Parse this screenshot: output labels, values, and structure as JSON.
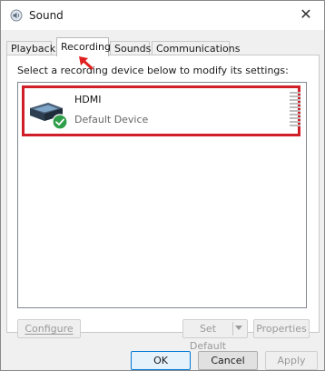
{
  "window": {
    "title": "Sound",
    "close_glyph": "✕"
  },
  "tabs": [
    {
      "label": "Playback",
      "active": false
    },
    {
      "label": "Recording",
      "active": true
    },
    {
      "label": "Sounds",
      "active": false
    },
    {
      "label": "Communications",
      "active": false
    }
  ],
  "recording": {
    "instruction": "Select a recording device below to modify its settings:",
    "devices": [
      {
        "name": "HDMI",
        "status": "Default Device",
        "icon": "hdmi-device-icon",
        "default_badge": "check-icon"
      }
    ]
  },
  "buttons": {
    "configure": "Configure",
    "set_default": "Set Default",
    "properties": "Properties",
    "ok": "OK",
    "cancel": "Cancel",
    "apply": "Apply"
  },
  "colors": {
    "highlight_border": "#d11f2a",
    "default_badge": "#2e9e4a",
    "annotation_arrow": "#e02020"
  }
}
